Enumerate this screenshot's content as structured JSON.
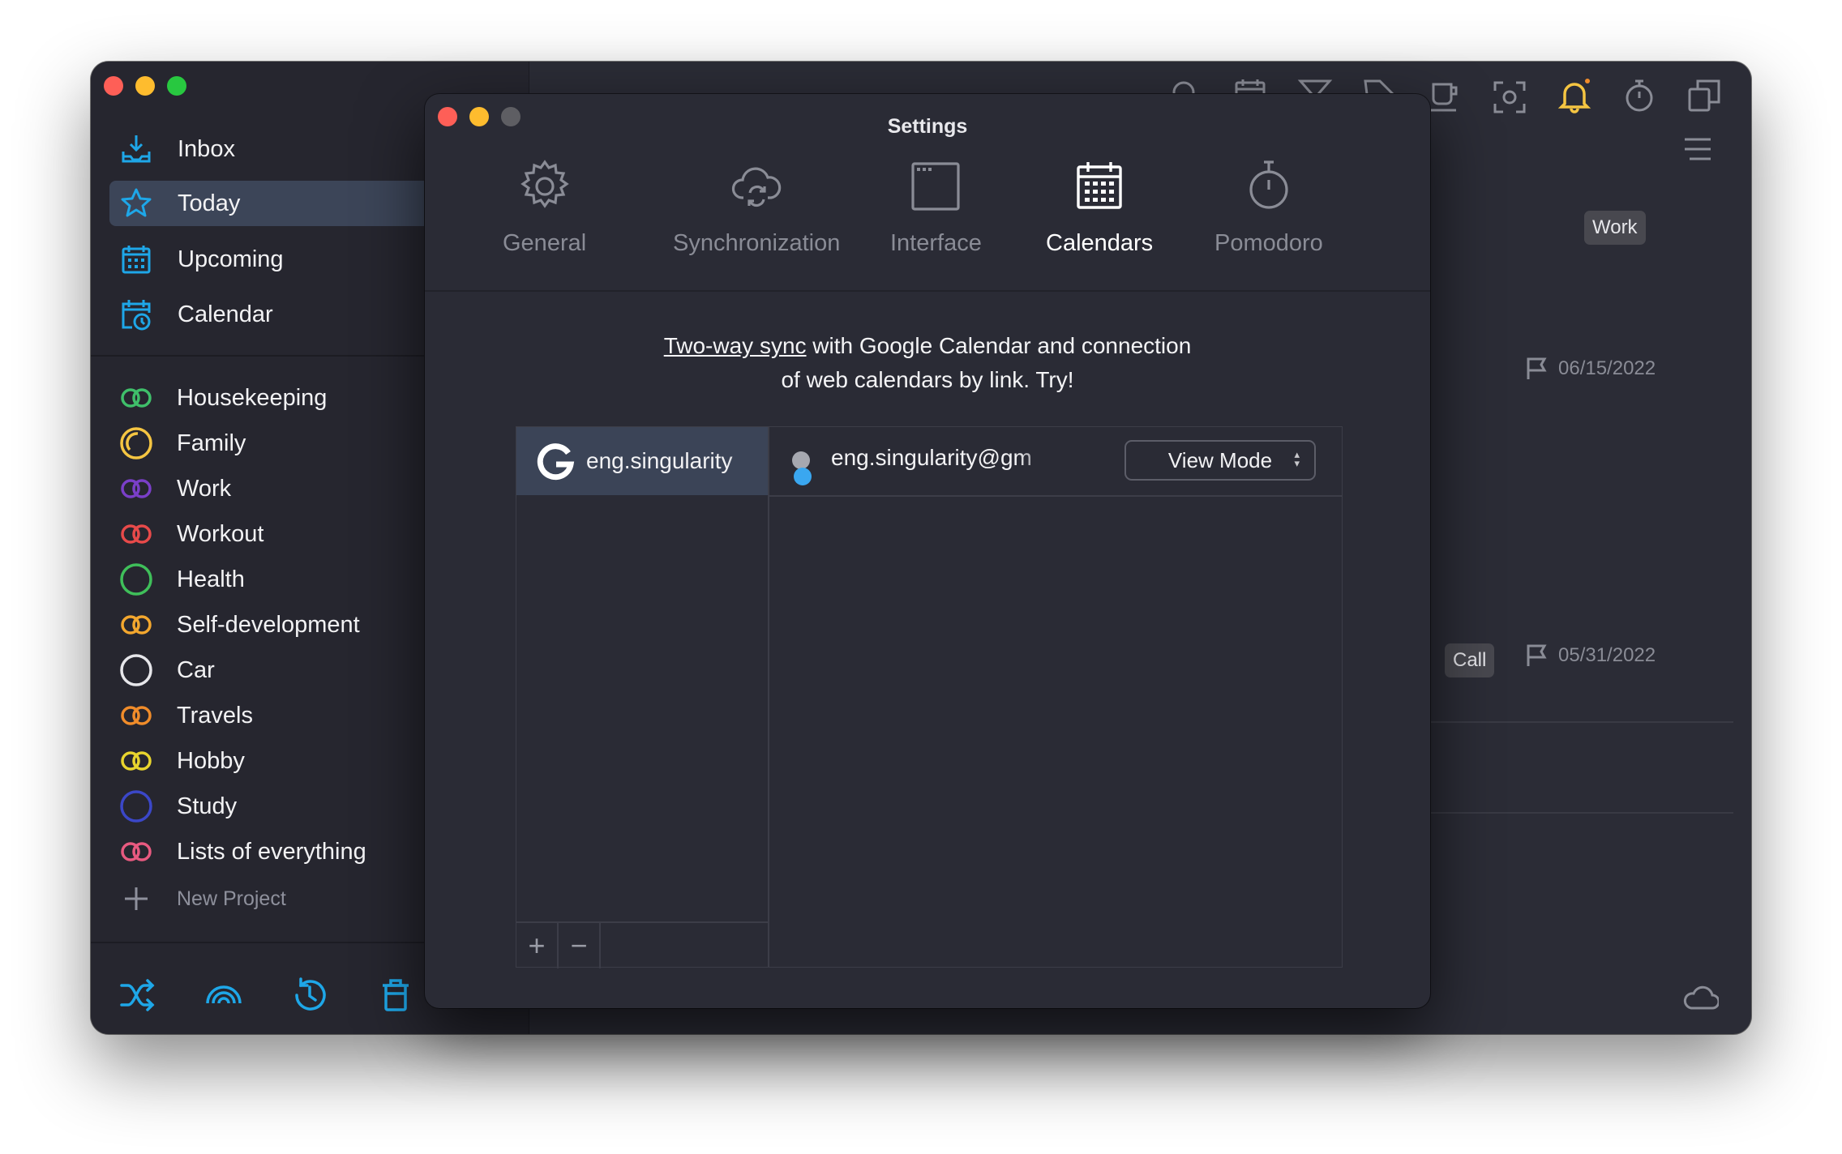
{
  "sidebar": {
    "nav": [
      {
        "label": "Inbox",
        "icon": "inbox-icon"
      },
      {
        "label": "Today",
        "icon": "star-icon",
        "active": true
      },
      {
        "label": "Upcoming",
        "icon": "calendar-grid-icon"
      },
      {
        "label": "Calendar",
        "icon": "calendar-clock-icon"
      }
    ],
    "projects": [
      {
        "label": "Housekeeping",
        "color": "#3fbf6a",
        "icon": "infinity-circle-icon"
      },
      {
        "label": "Family",
        "color": "#f5c542",
        "icon": "crescent-circle-icon"
      },
      {
        "label": "Work",
        "color": "#7a3fc8",
        "icon": "infinity-circle-icon"
      },
      {
        "label": "Workout",
        "color": "#e84a4a",
        "icon": "infinity-circle-icon"
      },
      {
        "label": "Health",
        "color": "#3fbf5a",
        "icon": "circle-icon"
      },
      {
        "label": "Self-development",
        "color": "#f3a72e",
        "icon": "infinity-circle-icon"
      },
      {
        "label": "Car",
        "color": "#e6e6ea",
        "icon": "circle-icon"
      },
      {
        "label": "Travels",
        "color": "#f08c2a",
        "icon": "infinity-circle-icon"
      },
      {
        "label": "Hobby",
        "color": "#e8d42e",
        "icon": "infinity-circle-icon"
      },
      {
        "label": "Study",
        "color": "#3b47c8",
        "icon": "circle-icon"
      },
      {
        "label": "Lists of everything",
        "color": "#e85a80",
        "icon": "infinity-circle-icon"
      }
    ],
    "new_project_label": "New Project",
    "bottom_icons": [
      "shuffle-icon",
      "rainbow-icon",
      "history-icon",
      "trash-icon"
    ]
  },
  "main": {
    "toolbar_icons": [
      "search-icon",
      "calendar-icon",
      "filter-icon",
      "tag-icon",
      "coffee-icon",
      "focus-icon",
      "bell-icon",
      "timer-icon",
      "copy-window-icon"
    ],
    "tags": {
      "work": "Work",
      "call": "Call"
    },
    "dates": [
      "06/15/2022",
      "05/31/2022"
    ]
  },
  "settings": {
    "title": "Settings",
    "tabs": [
      {
        "label": "General",
        "icon": "gear-icon"
      },
      {
        "label": "Synchronization",
        "icon": "cloud-sync-icon"
      },
      {
        "label": "Interface",
        "icon": "window-icon"
      },
      {
        "label": "Calendars",
        "icon": "calendar-icon",
        "active": true
      },
      {
        "label": "Pomodoro",
        "icon": "stopwatch-icon"
      }
    ],
    "promo": {
      "link": "Two-way sync",
      "line1_rest": " with Google Calendar and connection",
      "line2": "of web calendars by link. Try!"
    },
    "account": {
      "name": "eng.singularity",
      "icon": "google-icon"
    },
    "calendar": {
      "name": "eng.singularity@gm",
      "mode": "View Mode"
    },
    "add_label": "+",
    "remove_label": "−"
  },
  "colors": {
    "accent": "#1ea7e8",
    "bell": "#f5c542",
    "active_bg": "#3c4558"
  }
}
